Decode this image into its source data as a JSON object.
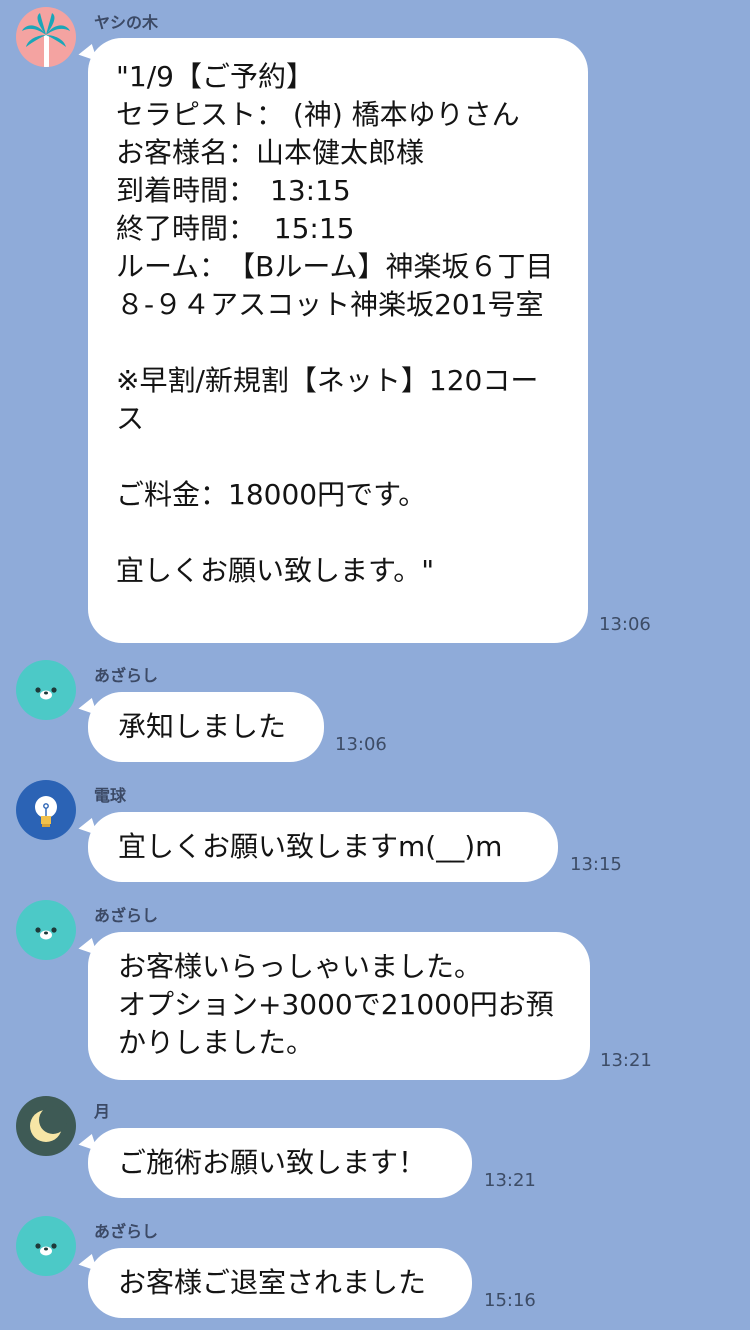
{
  "messages": [
    {
      "sender": "ヤシの木",
      "avatar_icon": "palm-tree-icon",
      "avatar_bg": "#f4a3a1",
      "text": "\"1/9【ご予約】\nセラピスト： (神) 橋本ゆりさん\nお客様名：山本健太郎様\n到着時間：　13:15\n終了時間：  15:15\nルーム：　【Bルーム】神楽坂６丁目８-９４アスコット神楽坂201号室\n\n※早割/新規割【ネット】120コース\n\nご料金：18000円です。\n\n宜しくお願い致します。\"",
      "time": "13:06"
    },
    {
      "sender": "あざらし",
      "avatar_icon": "seal-icon",
      "avatar_bg": "#4cc9c7",
      "text": "承知しました",
      "time": "13:06"
    },
    {
      "sender": "電球",
      "avatar_icon": "lightbulb-icon",
      "avatar_bg": "#2b63b5",
      "text": "宜しくお願い致しますm(__)m",
      "time": "13:15"
    },
    {
      "sender": "あざらし",
      "avatar_icon": "seal-icon",
      "avatar_bg": "#4cc9c7",
      "text": "お客様いらっしゃいました。\nオプション+3000で21000円お預かりしました。",
      "time": "13:21"
    },
    {
      "sender": "月",
      "avatar_icon": "moon-icon",
      "avatar_bg": "#3e5a55",
      "text": "ご施術お願い致します！",
      "time": "13:21"
    },
    {
      "sender": "あざらし",
      "avatar_icon": "seal-icon",
      "avatar_bg": "#4cc9c7",
      "text": "お客様ご退室されました",
      "time": "15:16"
    }
  ]
}
